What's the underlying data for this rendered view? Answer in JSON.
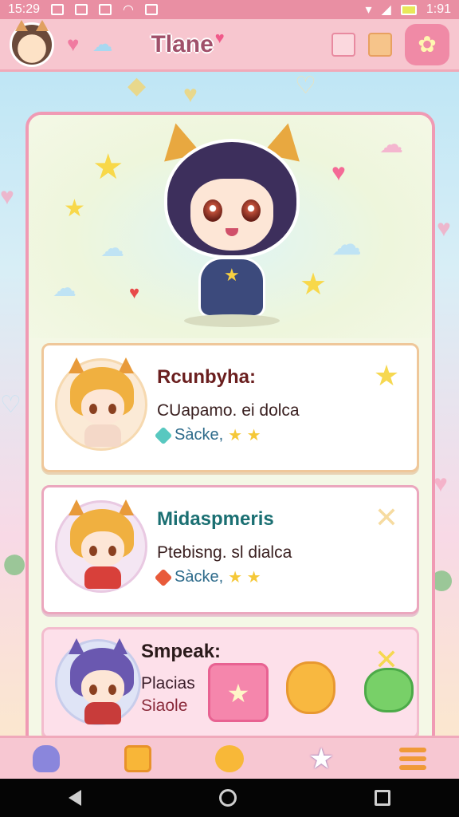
{
  "status_bar": {
    "time_left": "15:29",
    "time_right": "1:91"
  },
  "app_bar": {
    "title": "Tlane"
  },
  "characters": [
    {
      "name": "Rcunbyha:",
      "desc": "CUapamo. ei dolca",
      "tag": "Sàcke,",
      "stars": "★ ★",
      "favorite": true
    },
    {
      "name": "Midaspmeris",
      "desc": "Ptebisng. sl dialca",
      "tag": "Sàcke,",
      "stars": "★ ★",
      "favorite": false
    }
  ],
  "last_card": {
    "name": "Smpeak:",
    "line1": "Placias",
    "line2": "Siaole"
  },
  "icons": {
    "settings": "flower-icon",
    "fav": "star-icon",
    "fav_off": "close-icon",
    "nav": [
      "ghost-icon",
      "frame-icon",
      "chick-icon",
      "star-icon",
      "menu-icon"
    ]
  },
  "colors": {
    "app_bar": "#f7c6cf",
    "accent": "#f08aa6",
    "card_border": "#f09ab4",
    "title": "#a0506a"
  }
}
